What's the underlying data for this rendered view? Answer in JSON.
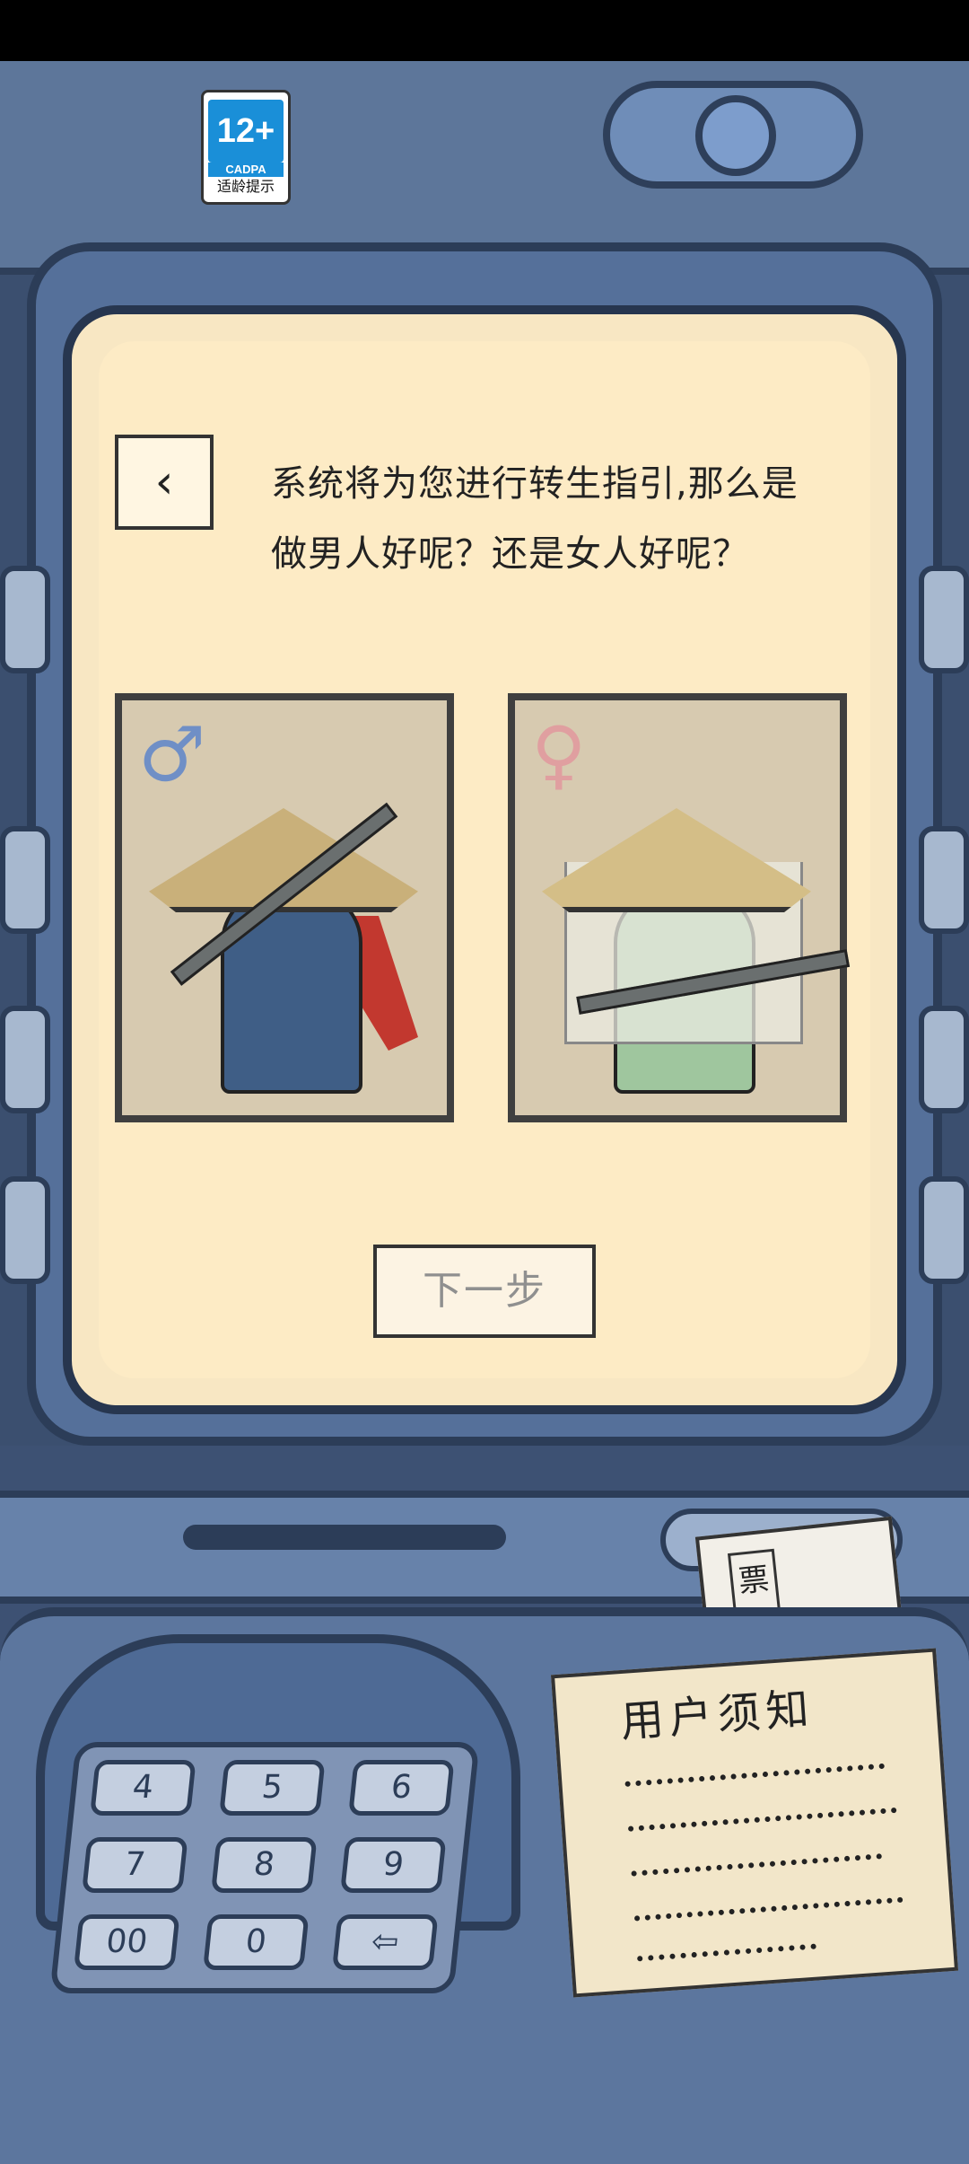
{
  "age_rating": {
    "age": "12+",
    "org": "CADPA",
    "tip": "适龄提示"
  },
  "screen": {
    "back_icon": "back-arrow-icon",
    "dialog_text": "系统将为您进行转生指引,那么是做男人好呢？还是女人好呢？",
    "choices": [
      {
        "id": "male",
        "symbol": "♂",
        "icon": "male-symbol-icon",
        "color": "#6f8fc6"
      },
      {
        "id": "female",
        "symbol": "♀",
        "icon": "female-symbol-icon",
        "color": "#e09fa0"
      }
    ],
    "next_button": "下一步"
  },
  "machine": {
    "keypad_keys": [
      "4",
      "5",
      "6",
      "7",
      "8",
      "9",
      "00",
      "0",
      "⇦"
    ],
    "notice_title": "用户须知",
    "ticket_text": "票"
  },
  "colors": {
    "screen_bg": "#fdebc5",
    "frame": "#2c3d58",
    "body": "#5c769e"
  }
}
